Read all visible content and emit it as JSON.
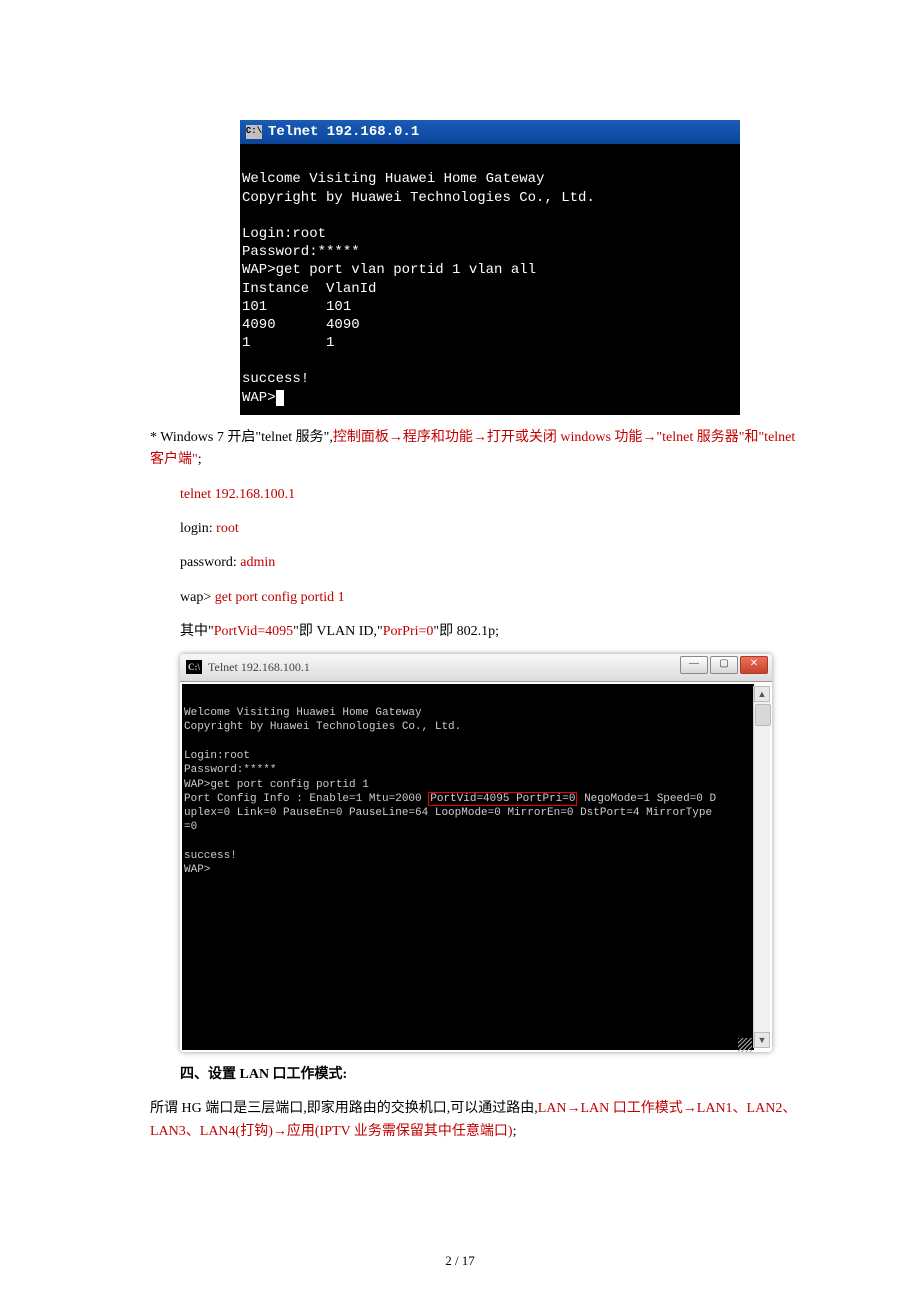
{
  "terminal1": {
    "title": "Telnet 192.168.0.1",
    "icon_text": "C:\\",
    "lines": {
      "welcome": "Welcome Visiting Huawei Home Gateway",
      "copyright": "Copyright by Huawei Technologies Co., Ltd.",
      "login": "Login:root",
      "password": "Password:*****",
      "cmd": "WAP>get port vlan portid 1 vlan all",
      "header": "Instance  VlanId",
      "r1": "101       101",
      "r2": "4090      4090",
      "r3": "1         1",
      "success": "success!",
      "prompt": "WAP>"
    }
  },
  "body": {
    "para1": {
      "prefix": "* Windows 7 开启\"telnet 服务\",",
      "path": "控制面板→程序和功能→打开或关闭 windows 功能→\"telnet 服务器\"和\"telnet 客户端\"",
      "suffix": ";"
    },
    "telnet_cmd": {
      "cmd": "telnet ",
      "ip": "192.168.100.1"
    },
    "login_line": {
      "label": "login: ",
      "value": "root"
    },
    "password_line": {
      "label": "password: ",
      "value": "admin"
    },
    "wap_line": {
      "label": "wap> ",
      "value": "get port config portid 1"
    },
    "explain": {
      "prefix": "其中\"",
      "k1": "PortVid=4095",
      "mid1": "\"即 VLAN ID,\"",
      "k2": "PorPri=0",
      "mid2": "\"即 802.1p;"
    }
  },
  "terminal2": {
    "title": "Telnet 192.168.100.1",
    "icon_text": "C:\\",
    "lines": {
      "welcome": "Welcome Visiting Huawei Home Gateway",
      "copyright": "Copyright by Huawei Technologies Co., Ltd.",
      "login": "Login:root",
      "password": "Password:*****",
      "cmd": "WAP>get port config portid 1",
      "info_pre": "Port Config Info : Enable=1 Mtu=2000 ",
      "info_box": "PortVid=4095 PortPri=0",
      "info_post": " NegoMode=1 Speed=0 D",
      "info2": "uplex=0 Link=0 PauseEn=0 PauseLine=64 LoopMode=0 MirrorEn=0 DstPort=4 MirrorType",
      "info3": "=0",
      "success": "success!",
      "prompt": "WAP>"
    }
  },
  "section4": {
    "heading": "四、设置 LAN 口工作模式:",
    "para": {
      "pre": "所谓 HG 端口是三层端口,即家用路由的交换机口,可以通过路由,",
      "path": "LAN→LAN 口工作模式→LAN1、LAN2、LAN3、LAN4(打钩)→应用(IPTV 业务需保留其中任意端口)",
      "suffix": ";"
    }
  },
  "page_number": "2 / 17"
}
